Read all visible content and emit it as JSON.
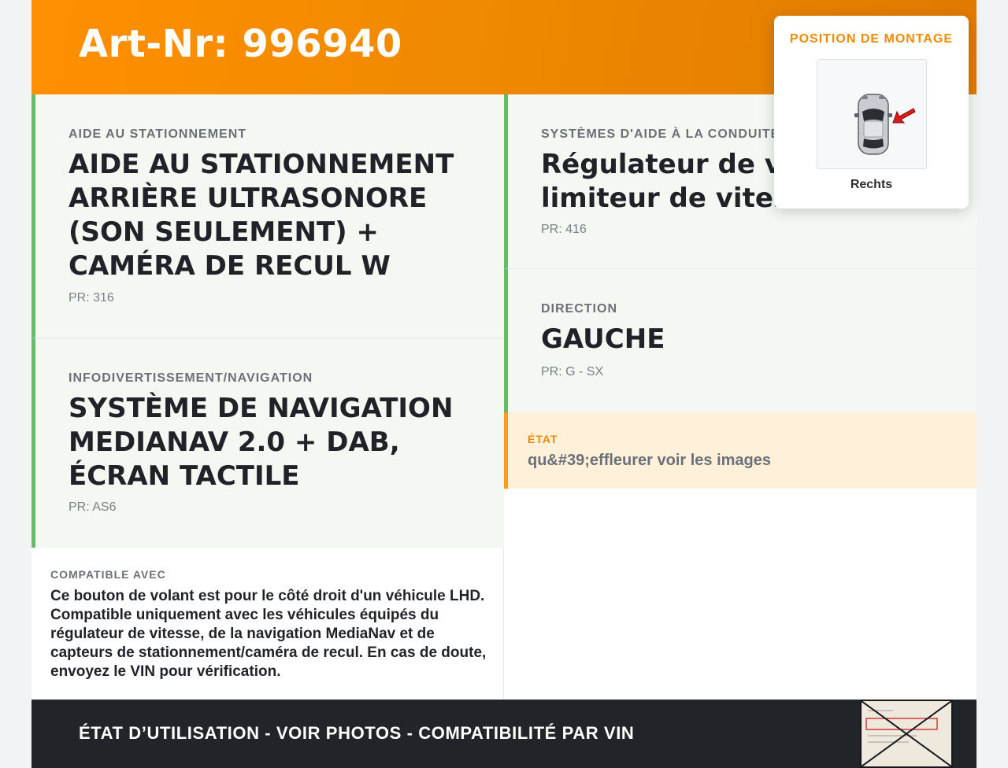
{
  "header": {
    "title": "Art-Nr: 996940"
  },
  "options": [
    {
      "category": "AIDE AU STATIONNEMENT",
      "value": "AIDE AU STATIONNEMENT ARRIÈRE ULTRASONORE (SON SEULEMENT) + CAMÉRA DE RECUL W",
      "pr": "PR: 316"
    },
    {
      "category": "INFODIVERTISSEMENT/NAVIGATION",
      "value": "SYSTÈME DE NAVIGATION MEDIANAV 2.0 + DAB, ÉCRAN TACTILE",
      "pr": "PR: AS6"
    },
    {
      "category": "SYSTÈMES D'AIDE À LA CONDUITE",
      "value": "Régulateur de vitesse et limiteur de vitesse",
      "pr": "PR: 416"
    },
    {
      "category": "DIRECTION",
      "value": "GAUCHE",
      "pr": "PR: G - SX"
    }
  ],
  "etat": {
    "label": "ÉTAT",
    "value": "qu&#39;effleurer voir les images"
  },
  "compat": {
    "label": "COMPATIBLE AVEC",
    "text": "Ce bouton de volant est pour le côté droit d'un véhicule LHD. Compatible uniquement avec les véhicules équipés du régulateur de vitesse, de la navigation MediaNav et de capteurs de stationnement/caméra de recul. En cas de doute, envoyez le VIN pour vérification."
  },
  "footer": {
    "text": "ÉTAT D’UTILISATION - VOIR PHOTOS - COMPATIBILITÉ PAR VIN"
  },
  "popup": {
    "title": "POSITION DE MONTAGE",
    "caption": "Rechts",
    "icon": "car-top-view-icon",
    "arrow_color": "#e01a1a"
  },
  "colors": {
    "accent": "#f08a00",
    "green_border": "#66bb6a",
    "footer_bg": "#212529"
  }
}
